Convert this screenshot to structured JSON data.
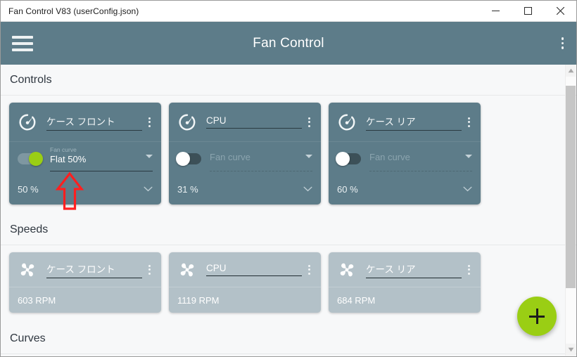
{
  "window": {
    "title": "Fan Control V83 (userConfig.json)",
    "minimize_label": "Minimize",
    "maximize_label": "Maximize",
    "close_label": "Close"
  },
  "appbar": {
    "title": "Fan Control",
    "menu_icon": "hamburger-icon",
    "overflow_icon": "kebab-menu-icon"
  },
  "sections": {
    "controls": "Controls",
    "speeds": "Speeds",
    "curves": "Curves"
  },
  "controls": [
    {
      "name": "ケース フロント",
      "icon": "gauge-icon",
      "toggle_on": true,
      "curve_label": "Fan curve",
      "curve_value": "Flat 50%",
      "percent": "50 %"
    },
    {
      "name": "CPU",
      "icon": "gauge-icon",
      "toggle_on": false,
      "curve_label": "",
      "curve_placeholder": "Fan curve",
      "curve_value": "",
      "percent": "31 %"
    },
    {
      "name": "ケース リア",
      "icon": "gauge-icon",
      "toggle_on": false,
      "curve_label": "",
      "curve_placeholder": "Fan curve",
      "curve_value": "",
      "percent": "60 %"
    }
  ],
  "speeds": [
    {
      "name": "ケース フロント",
      "icon": "fan-icon",
      "rpm": "603 RPM"
    },
    {
      "name": "CPU",
      "icon": "fan-icon",
      "rpm": "1119 RPM"
    },
    {
      "name": "ケース リア",
      "icon": "fan-icon",
      "rpm": "684 RPM"
    }
  ],
  "fab": {
    "label": "+",
    "icon": "plus-icon",
    "color": "#9ace14"
  },
  "annotation": {
    "type": "arrow-up",
    "color": "#ff1f1f",
    "points_at": "Flat 50%"
  },
  "colors": {
    "appbar": "#5d7c89",
    "control_card": "#5d7c89",
    "speed_card": "#b3c1c8",
    "accent_green": "#9ace14",
    "page_bg": "#f7f8f9"
  }
}
